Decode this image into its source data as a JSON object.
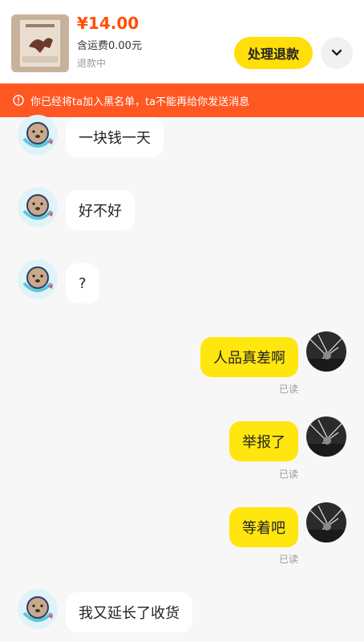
{
  "header": {
    "price": "¥14.00",
    "shipping": "含运费0.00元",
    "refund_status": "退款中",
    "refund_button": "处理退款"
  },
  "banner": {
    "text": "你已经将ta加入黑名单，ta不能再给你发送消息"
  },
  "messages": [
    {
      "side": "in",
      "text": "一块钱一天"
    },
    {
      "side": "in",
      "text": "好不好"
    },
    {
      "side": "in",
      "text": "?"
    },
    {
      "side": "out",
      "text": "人品真差啊",
      "status": "已读"
    },
    {
      "side": "out",
      "text": "举报了",
      "status": "已读"
    },
    {
      "side": "out",
      "text": "等着吧",
      "status": "已读"
    },
    {
      "side": "in",
      "text": "我又延长了收货"
    }
  ],
  "colors": {
    "accent": "#ffde0a",
    "banner": "#ff5722",
    "price": "#ff5000"
  }
}
